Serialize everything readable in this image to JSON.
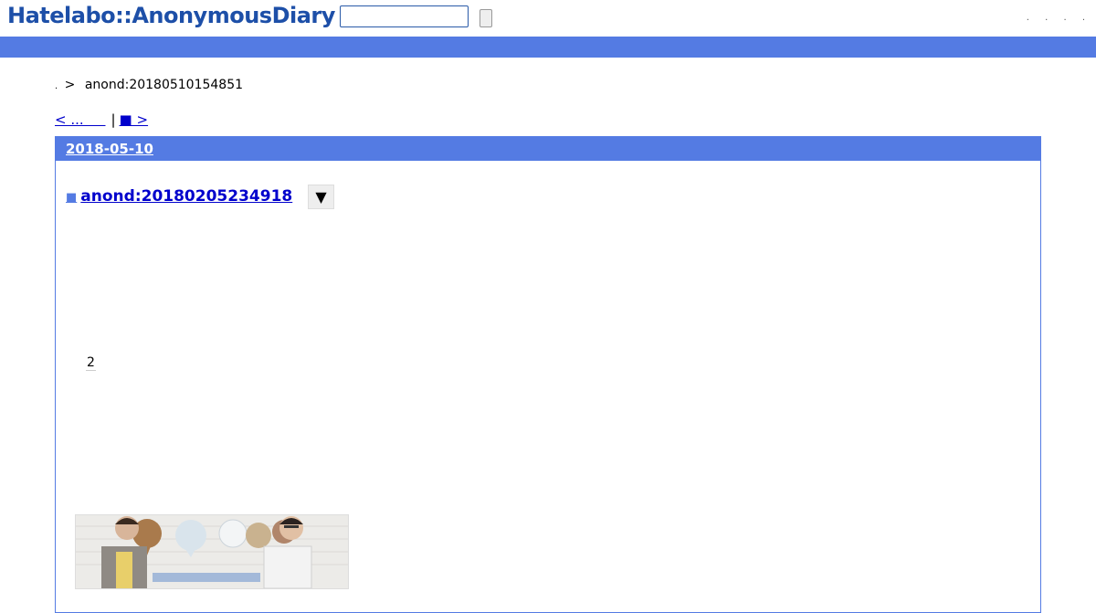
{
  "header": {
    "logo": "Hatelabo::AnonymousDiary",
    "search_value": "",
    "links": [
      ".",
      ".",
      ".",
      "."
    ]
  },
  "breadcrumb": {
    "home": ".",
    "separator": ">",
    "current": "anond:20180510154851"
  },
  "pager": {
    "prev": "< ...     ",
    "separator": "|",
    "next": "■ >"
  },
  "day": {
    "date": "2018-05-10"
  },
  "entry": {
    "marker": "■",
    "title": "anond:20180205234918",
    "menu_icon": "▼",
    "count": "2"
  },
  "colors": {
    "logo": "#1d4fa8",
    "accent": "#547be3",
    "link": "#0000cc"
  }
}
